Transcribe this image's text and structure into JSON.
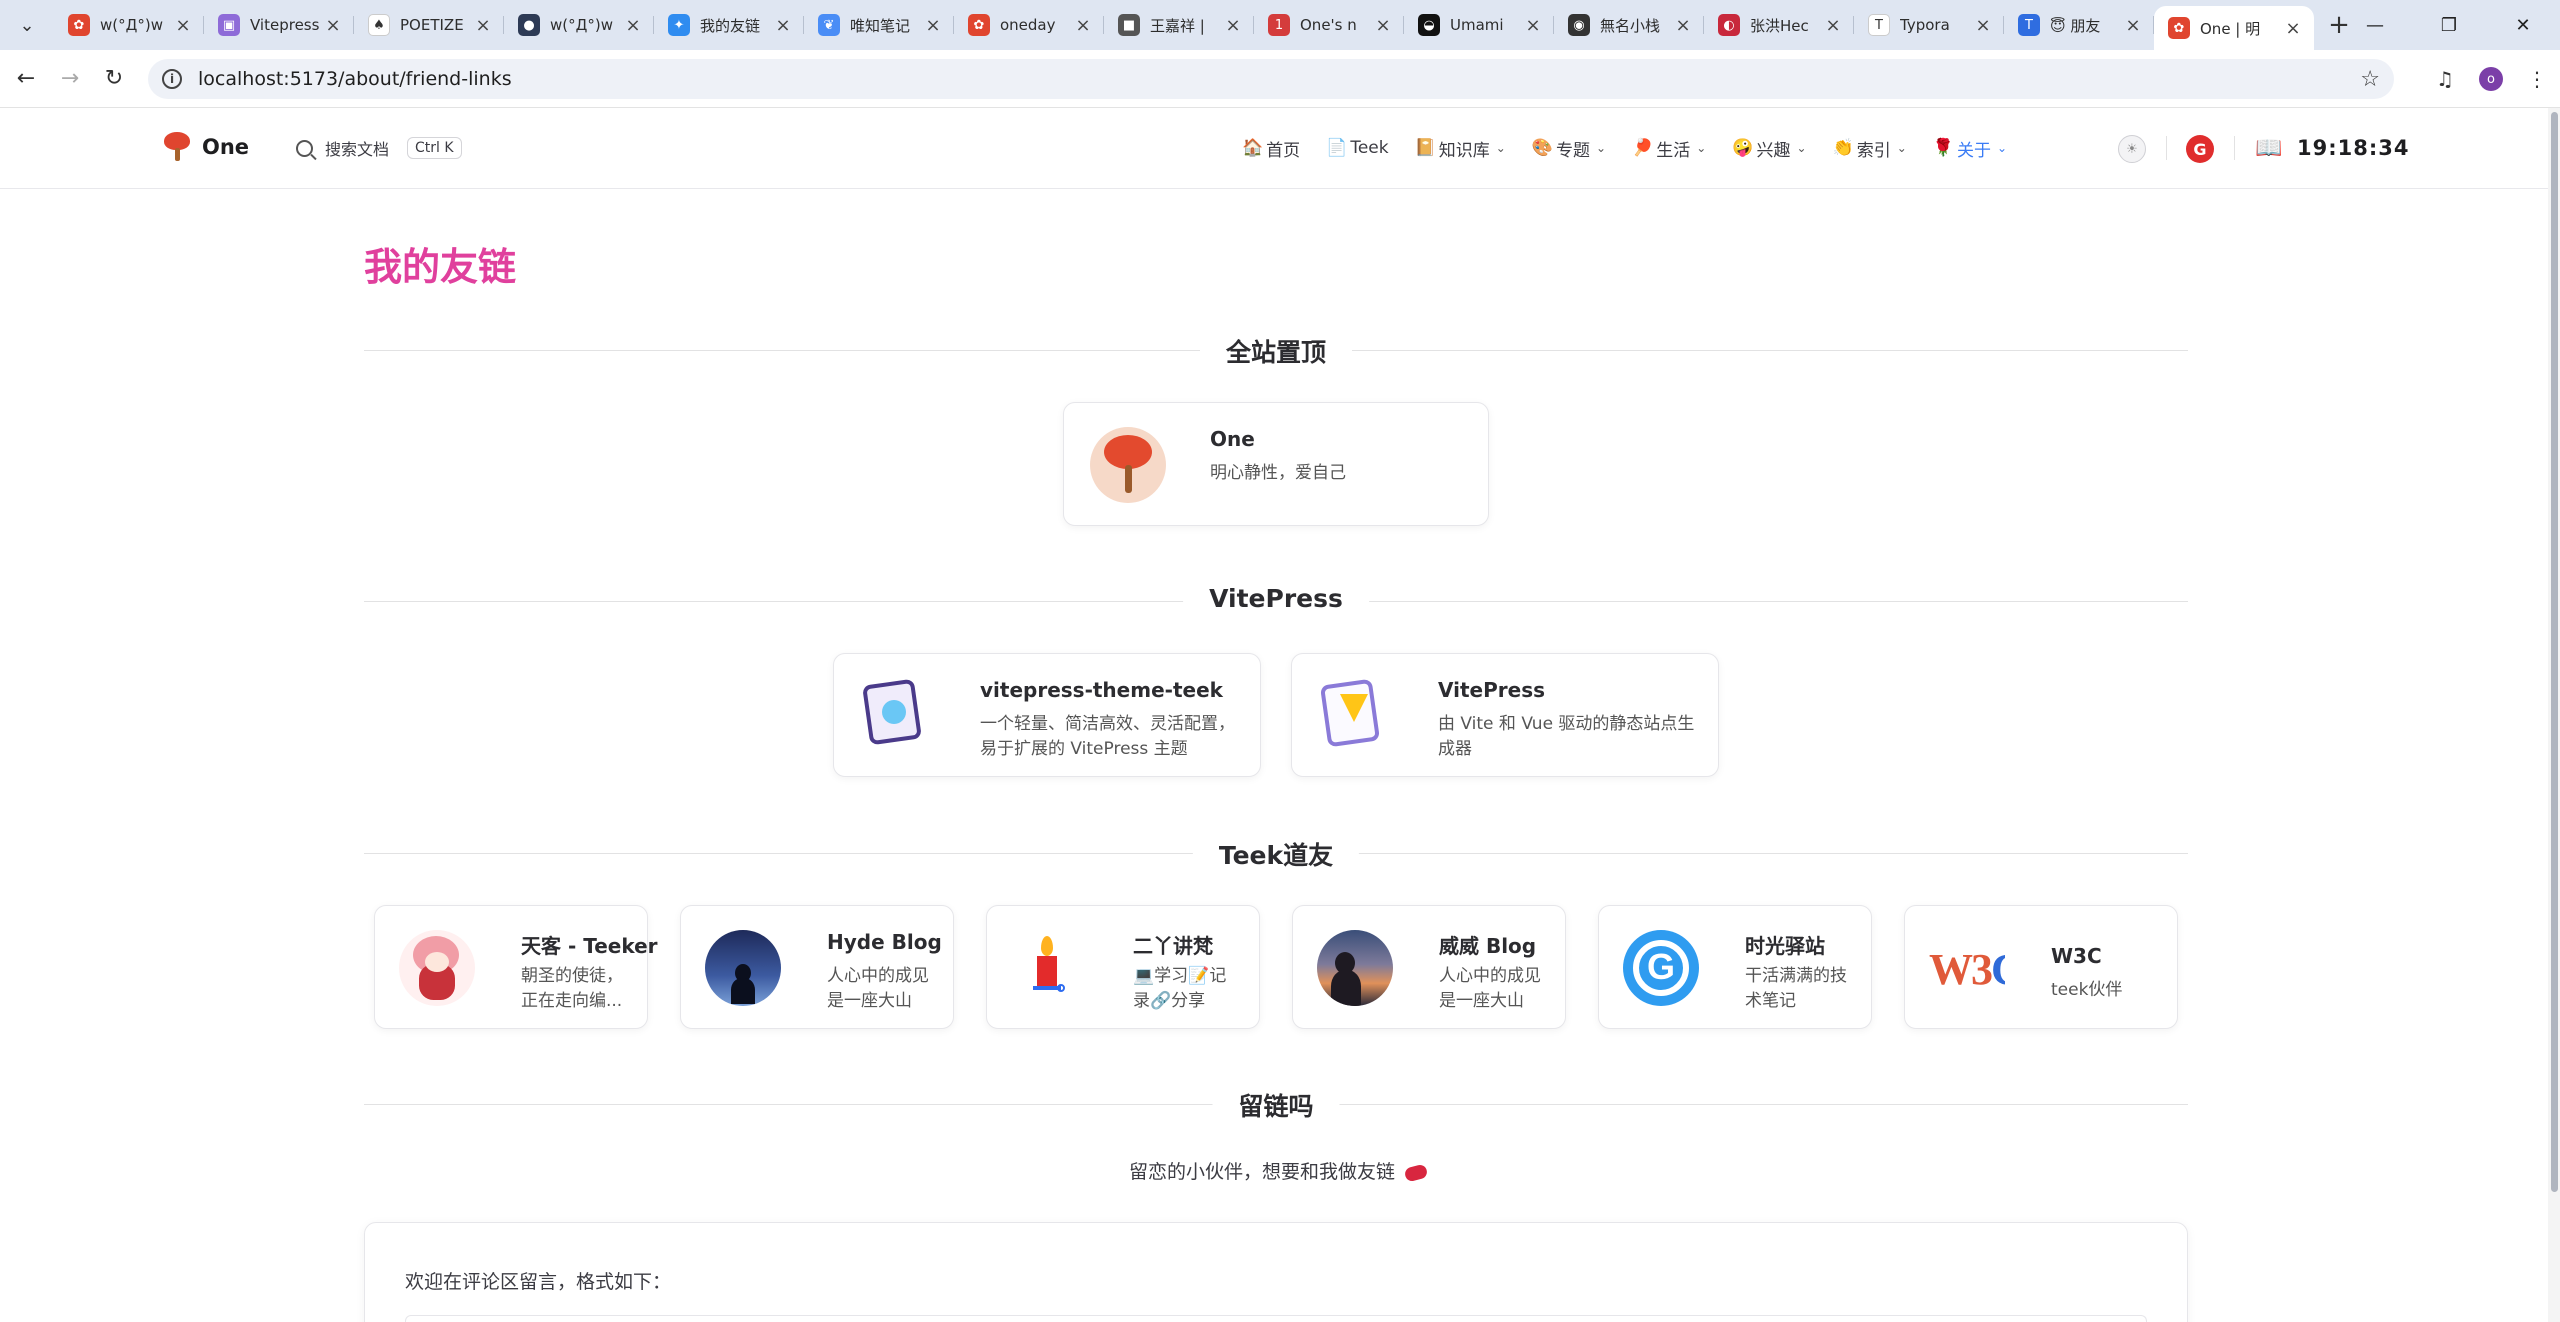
{
  "browser": {
    "tabs": [
      {
        "title": "w(°Д°)w",
        "fav_color": "#e0452f",
        "fav_glyph": "✿"
      },
      {
        "title": "Vitepress",
        "fav_color": "#8e6bd8",
        "fav_glyph": "▣"
      },
      {
        "title": "POETIZE",
        "fav_color": "#ffffff",
        "fav_glyph": "♠"
      },
      {
        "title": "w(°Д°)w",
        "fav_color": "#2d3a55",
        "fav_glyph": "●"
      },
      {
        "title": "我的友链",
        "fav_color": "#2f8cf0",
        "fav_glyph": "✦"
      },
      {
        "title": "唯知笔记",
        "fav_color": "#4a8df6",
        "fav_glyph": "❦"
      },
      {
        "title": "oneday",
        "fav_color": "#e0452f",
        "fav_glyph": "✿"
      },
      {
        "title": "王嘉祥 |",
        "fav_color": "#555555",
        "fav_glyph": "■"
      },
      {
        "title": "One's n",
        "fav_color": "#d43c3c",
        "fav_glyph": "1"
      },
      {
        "title": "Umami",
        "fav_color": "#111111",
        "fav_glyph": "◒"
      },
      {
        "title": "無名小栈",
        "fav_color": "#333333",
        "fav_glyph": "◉"
      },
      {
        "title": "张洪Hec",
        "fav_color": "#c8283c",
        "fav_glyph": "◐"
      },
      {
        "title": "Typora",
        "fav_color": "#ffffff",
        "fav_glyph": "T"
      },
      {
        "title": "😇 朋友",
        "fav_color": "#2f6de0",
        "fav_glyph": "T"
      },
      {
        "title": "One | 明",
        "fav_color": "#e0452f",
        "fav_glyph": "✿"
      }
    ],
    "url": "localhost:5173/about/friend-links",
    "profile_initial": "o"
  },
  "site": {
    "brand": "One",
    "search_label": "搜索文档",
    "search_shortcut": "Ctrl K",
    "menu": [
      {
        "icon": "🏠",
        "label": "首页",
        "dropdown": false,
        "active": false
      },
      {
        "icon": "📄",
        "label": "Teek",
        "dropdown": false,
        "active": false
      },
      {
        "icon": "📔",
        "label": "知识库",
        "dropdown": true,
        "active": false
      },
      {
        "icon": "🎨",
        "label": "专题",
        "dropdown": true,
        "active": false
      },
      {
        "icon": "🏓",
        "label": "生活",
        "dropdown": true,
        "active": false
      },
      {
        "icon": "🤪",
        "label": "兴趣",
        "dropdown": true,
        "active": false
      },
      {
        "icon": "👏",
        "label": "索引",
        "dropdown": true,
        "active": false
      },
      {
        "icon": "🌹",
        "label": "关于",
        "dropdown": true,
        "active": true
      }
    ],
    "clock": "19:18:34"
  },
  "content": {
    "page_title": "我的友链",
    "sections": [
      {
        "title": "全站置顶",
        "links": [
          {
            "name": "One",
            "desc": "明心静性，爱自己",
            "avatar": "tree"
          }
        ]
      },
      {
        "title": "VitePress",
        "links": [
          {
            "name": "vitepress-theme-teek",
            "desc": "一个轻量、简洁高效、灵活配置，易于扩展的 VitePress 主题",
            "avatar": "teek"
          },
          {
            "name": "VitePress",
            "desc": "由 Vite 和 Vue 驱动的静态站点生成器",
            "avatar": "vitepress"
          }
        ]
      },
      {
        "title": "Teek道友",
        "links": [
          {
            "name": "天客 - Teeker",
            "desc": "朝圣的使徒，正在走向编...",
            "avatar": "anime"
          },
          {
            "name": "Hyde Blog",
            "desc": "人心中的成见是一座大山",
            "avatar": "night"
          },
          {
            "name": "二丫讲梵",
            "desc": "💻学习📝记录🔗分享",
            "avatar": "candle"
          },
          {
            "name": "威威 Blog",
            "desc": "人心中的成见是一座大山",
            "avatar": "sunset"
          },
          {
            "name": "时光驿站",
            "desc": "干活满满的技术笔记",
            "avatar": "gbadge"
          },
          {
            "name": "W3C",
            "desc": "teek伙伴",
            "avatar": "w3c"
          }
        ]
      },
      {
        "title": "留链吗",
        "links": []
      }
    ],
    "invite_text": "留恋的小伙伴，想要和我做友链",
    "comment_intro": "欢迎在评论区留言，格式如下："
  }
}
